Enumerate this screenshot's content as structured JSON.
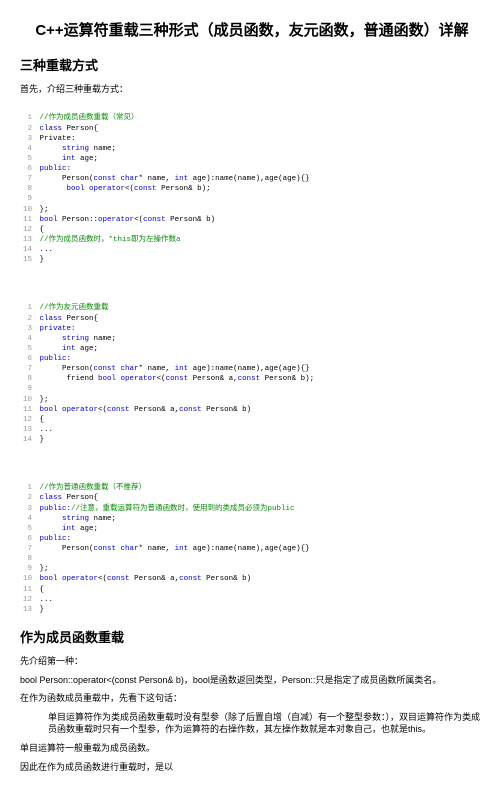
{
  "title": "C++运算符重载三种形式（成员函数，友元函数，普通函数）详解",
  "h2_1": "三种重载方式",
  "intro1": "首先，介绍三种重载方式：",
  "code1": {
    "l1c": "//作为成员函数重载（常见）",
    "l2a": "class",
    "l2b": " Person{",
    "l3": "Private:",
    "l4a": "string",
    "l4b": " name;",
    "l5a": "int",
    "l5b": " age;",
    "l6": "public:",
    "l7a": "Person(",
    "l7b": "const char",
    "l7c": "* name, ",
    "l7d": "int",
    "l7e": " age):name(name),age(age){}",
    "l8a": "bool operator",
    "l8b": "<(",
    "l8c": "const",
    "l8d": " Person& b);",
    "l10": "};",
    "l11a": "bool",
    "l11b": " Person::",
    "l11c": "operator",
    "l11d": "<(",
    "l11e": "const",
    "l11f": " Person& b)",
    "l12": "{",
    "l13": "//作为成员函数时，*this即为左操作数a",
    "l14": "...",
    "l15": "}"
  },
  "code2": {
    "l1c": "//作为友元函数重载",
    "l2a": "class",
    "l2b": " Person{",
    "l3": "private:",
    "l4a": "string",
    "l4b": " name;",
    "l5a": "int",
    "l5b": " age;",
    "l6": "public:",
    "l7a": "Person(",
    "l7b": "const char",
    "l7c": "* name, ",
    "l7d": "int",
    "l7e": " age):name(name),age(age){}",
    "l8a": "friend ",
    "l8b": "bool operator",
    "l8c": "<(",
    "l8d": "const",
    "l8e": " Person& a,",
    "l8f": "const",
    "l8g": " Person& b);",
    "l10": "};",
    "l11a": "bool operator",
    "l11b": "<(",
    "l11c": "const",
    "l11d": " Person& a,",
    "l11e": "const",
    "l11f": " Person& b)",
    "l12": "{",
    "l13": "...",
    "l14": "}"
  },
  "code3": {
    "l1c": "//作为普通函数重载（不推荐）",
    "l2a": "class",
    "l2b": " Person{",
    "l3a": "public:",
    "l3b": "//注意，重载运算符为普通函数时，使用到的类成员必须为public",
    "l4a": "string",
    "l4b": " name;",
    "l5a": "int",
    "l5b": " age;",
    "l6": "public:",
    "l7a": "Person(",
    "l7b": "const char",
    "l7c": "* name, ",
    "l7d": "int",
    "l7e": " age):name(name),age(age){}",
    "l9": "};",
    "l10a": "bool operator",
    "l10b": "<(",
    "l10c": "const",
    "l10d": " Person& a,",
    "l10e": "const",
    "l10f": " Person& b)",
    "l11": "{",
    "l12": "...",
    "l13": "}"
  },
  "h2_2": "作为成员函数重载",
  "p2": "先介绍第一种：",
  "p3": "bool Person::operator<(const Person& b)，bool是函数返回类型，Person::只是指定了成员函数所属类名。",
  "p4": "在作为函数成员重载中，先看下这句话：",
  "p5": "单目运算符作为类成员函数重载时没有型参（除了后置自增（自减）有一个整型参数：），双目运算符作为类成员函数重载时只有一个型参，作为运算符的右操作数，其左操作数就是本对象自己，也就是this。",
  "p6": "单目运算符一般重载为成员函数。",
  "p7": "因此在作为成员函数进行重载时，是以"
}
